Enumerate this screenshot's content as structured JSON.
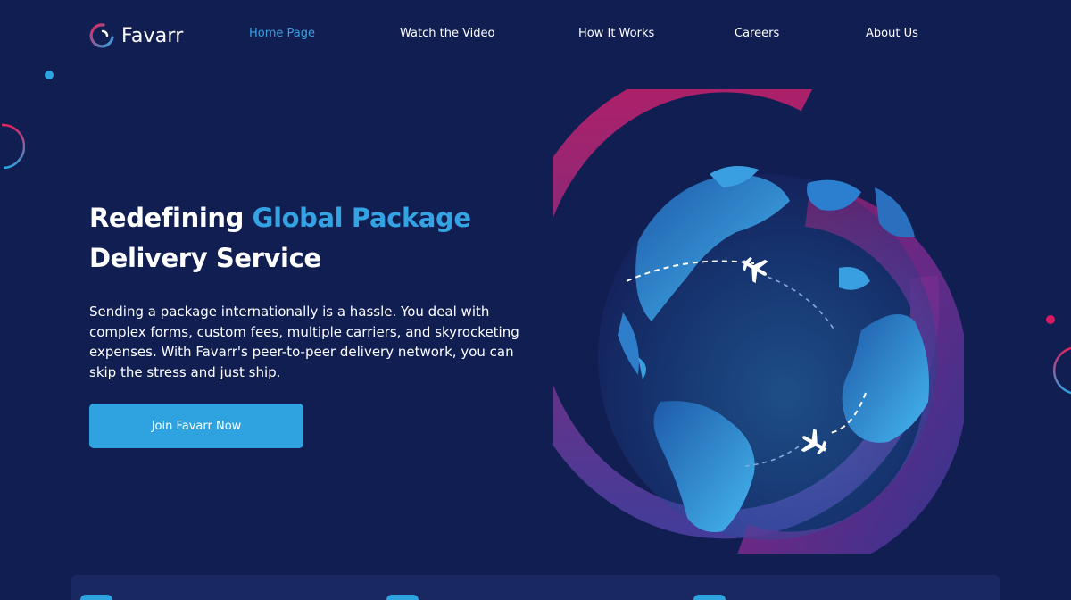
{
  "brand": {
    "name": "Favarr"
  },
  "nav": {
    "items": [
      {
        "label": "Home Page",
        "active": true
      },
      {
        "label": "Watch the Video"
      },
      {
        "label": "How It Works"
      },
      {
        "label": "Careers"
      },
      {
        "label": "About Us"
      }
    ]
  },
  "hero": {
    "title_part1": "Redefining ",
    "title_accent": "Global Package",
    "title_line2": "Delivery Service",
    "description": "Sending a package internationally is a hassle. You deal with complex forms, custom fees, multiple carriers, and skyrocketing expenses. With Favarr's peer-to-peer delivery network, you can skip the stress and just ship.",
    "cta_label": "Join Favarr Now"
  },
  "icons": {
    "logo": "favarr-ring-logo-icon",
    "plane_top": "airplane-icon",
    "plane_bottom": "airplane-icon",
    "globe": "globe-illustration"
  },
  "colors": {
    "background": "#111e52",
    "accent_blue": "#2ea3df",
    "accent_magenta": "#c2185b",
    "text": "#ffffff"
  }
}
